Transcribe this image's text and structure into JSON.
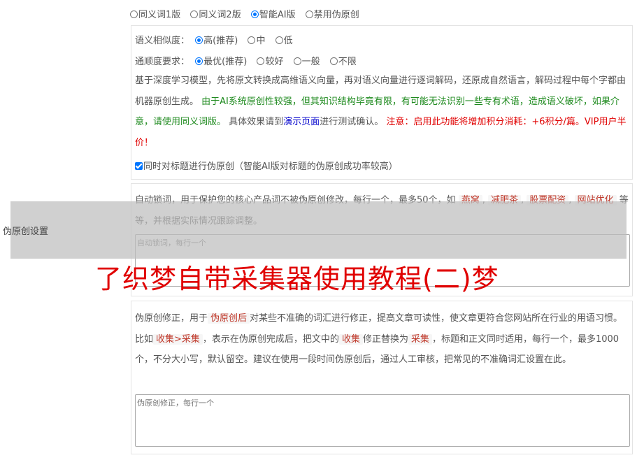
{
  "mode_options": [
    {
      "label": "同义词1版",
      "selected": false
    },
    {
      "label": "同义词2版",
      "selected": false
    },
    {
      "label": "智能AI版",
      "selected": true
    },
    {
      "label": "禁用伪原创",
      "selected": false
    }
  ],
  "similarity": {
    "label": "语义相似度：",
    "options": [
      {
        "label": "高(推荐)",
        "selected": true
      },
      {
        "label": "中",
        "selected": false
      },
      {
        "label": "低",
        "selected": false
      }
    ]
  },
  "fluency": {
    "label": "通顺度要求：",
    "options": [
      {
        "label": "最优(推荐)",
        "selected": true
      },
      {
        "label": "较好",
        "selected": false
      },
      {
        "label": "一般",
        "selected": false
      },
      {
        "label": "不限",
        "selected": false
      }
    ]
  },
  "ai_description": {
    "intro": "基于深度学习模型，先将原文转换成高维语义向量，再对语义向量进行逐词解码，还原成自然语言，解码过程中每个字都由机器原创生成。",
    "green_warning": "由于AI系统原创性较强，但其知识结构毕竟有限，有可能无法识别一些专有术语，造成语义破坏，如果介意，请使用同义词版。",
    "effect_prefix": "具体效果请到",
    "demo_link": "演示页面",
    "effect_suffix": "进行测试确认。",
    "red_note": "注意：启用此功能将增加积分消耗：+6积分/篇。VIP用户半价！"
  },
  "title_checkbox": {
    "label": "同时对标题进行伪原创（智能AI版对标题的伪原创成功率较高）",
    "checked": true
  },
  "lock_words": {
    "desc_prefix": "自动锁词，用于保护您的核心产品词不被伪原创修改，每行一个，最多50个，如",
    "examples": [
      "燕窝",
      "减肥茶",
      "股票配资",
      "网站优化"
    ],
    "desc_suffix": "等等，并根据实际情况跟踪调整。",
    "placeholder": "自动锁词，每行一个"
  },
  "side_label": "伪原创设置",
  "watermark": "了织梦自带采集器使用教程(二)梦",
  "correction": {
    "p1": "伪原创修正，用于",
    "tag1": "伪原创后",
    "p2": "对某些不准确的词汇进行修正，提高文章可读性，使文章更符合您网站所在行业的用语习惯。比如",
    "tag2": "收集>采集",
    "p3": "，表示在伪原创完成后，把文中的",
    "tag3": "收集",
    "p4": "修正替换为",
    "tag4": "采集",
    "p5": "，标题和正文同时适用，每行一个，最多1000个，不分大小写，默认留空。建议在使用一段时间伪原创后，通过人工审核，把常见的不准确词汇设置在此。",
    "placeholder": "伪原创修正，每行一个"
  },
  "colors": {
    "accent": "#0075ff",
    "warning_green": "#1e8a1e",
    "warning_red": "#e00000",
    "link_blue": "#0000cc"
  }
}
